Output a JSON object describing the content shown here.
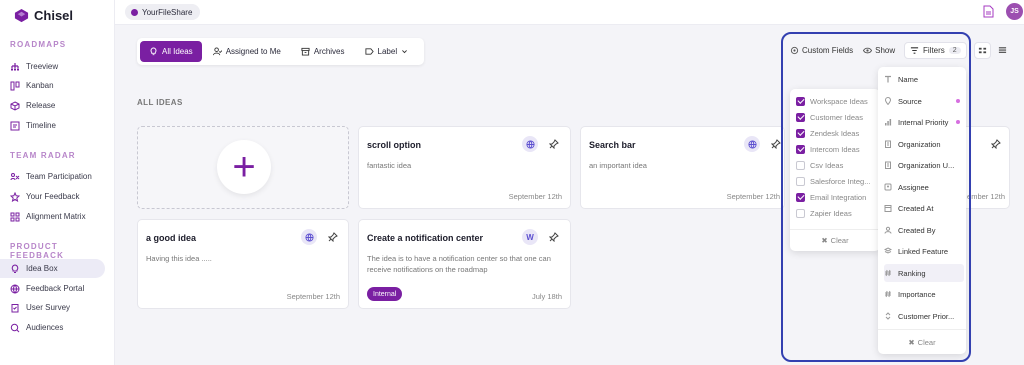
{
  "app": {
    "name": "Chisel"
  },
  "workspace": {
    "name": "YourFileShare"
  },
  "user": {
    "initials": "JS"
  },
  "sidebar": {
    "sections": [
      {
        "title": "ROADMAPS",
        "items": [
          {
            "label": "Treeview",
            "icon": "treeview-icon"
          },
          {
            "label": "Kanban",
            "icon": "kanban-icon"
          },
          {
            "label": "Release",
            "icon": "release-icon"
          },
          {
            "label": "Timeline",
            "icon": "timeline-icon"
          }
        ]
      },
      {
        "title": "TEAM RADAR",
        "items": [
          {
            "label": "Team Participation",
            "icon": "participation-icon"
          },
          {
            "label": "Your Feedback",
            "icon": "star-icon"
          },
          {
            "label": "Alignment Matrix",
            "icon": "matrix-icon"
          }
        ]
      },
      {
        "title": "PRODUCT FEEDBACK",
        "items": [
          {
            "label": "Idea Box",
            "icon": "lightbulb-icon"
          },
          {
            "label": "Feedback Portal",
            "icon": "globe-icon"
          },
          {
            "label": "User Survey",
            "icon": "survey-icon"
          },
          {
            "label": "Audiences",
            "icon": "audience-icon"
          }
        ]
      }
    ],
    "active_item": "Idea Box"
  },
  "tabs": [
    {
      "label": "All Ideas",
      "active": true
    },
    {
      "label": "Assigned to Me"
    },
    {
      "label": "Archives"
    },
    {
      "label": "Label"
    }
  ],
  "toolbar": {
    "custom_fields": "Custom Fields",
    "show": "Show",
    "filters": "Filters",
    "filters_count": "2"
  },
  "section_label": "ALL IDEAS",
  "cards": [
    {
      "title": "scroll option",
      "description": "fantastic idea",
      "date": "September 12th"
    },
    {
      "title": "Search bar",
      "description": "an important idea",
      "date": "September 12th"
    },
    {
      "title": "a good idea",
      "description": "Having this idea .....",
      "date": "September 12th"
    },
    {
      "title": "Create a notification center",
      "description": "The idea is to have a notification center so that one can receive notifications on the roadmap",
      "date": "July 18th",
      "badge": "Internal",
      "avatar": "W"
    },
    {
      "date": "ember 12th"
    }
  ],
  "source_filter": {
    "options": [
      {
        "label": "Workspace Ideas",
        "checked": true
      },
      {
        "label": "Customer Ideas",
        "checked": true
      },
      {
        "label": "Zendesk Ideas",
        "checked": true
      },
      {
        "label": "Intercom Ideas",
        "checked": true
      },
      {
        "label": "Csv Ideas",
        "checked": false
      },
      {
        "label": "Salesforce Integ...",
        "checked": false
      },
      {
        "label": "Email Integration",
        "checked": true
      },
      {
        "label": "Zapier Ideas",
        "checked": false
      }
    ],
    "clear_label": "Clear"
  },
  "filter_fields": {
    "items": [
      {
        "label": "Name",
        "icon": "text-icon"
      },
      {
        "label": "Source",
        "icon": "location-icon",
        "active": true
      },
      {
        "label": "Internal Priority",
        "icon": "bar-chart-icon",
        "active": true
      },
      {
        "label": "Organization",
        "icon": "building-icon"
      },
      {
        "label": "Organization U...",
        "icon": "building-icon"
      },
      {
        "label": "Assignee",
        "icon": "user-icon"
      },
      {
        "label": "Created At",
        "icon": "calendar-icon"
      },
      {
        "label": "Created By",
        "icon": "user-icon"
      },
      {
        "label": "Linked Feature",
        "icon": "layers-icon"
      },
      {
        "label": "Ranking",
        "icon": "hash-icon"
      },
      {
        "label": "Importance",
        "icon": "hash-icon"
      },
      {
        "label": "Customer Prior...",
        "icon": "sort-icon"
      }
    ],
    "clear_label": "Clear"
  },
  "colors": {
    "accent": "#7a1fa2",
    "highlight": "#3340b0",
    "dot": "#d66fe0"
  }
}
